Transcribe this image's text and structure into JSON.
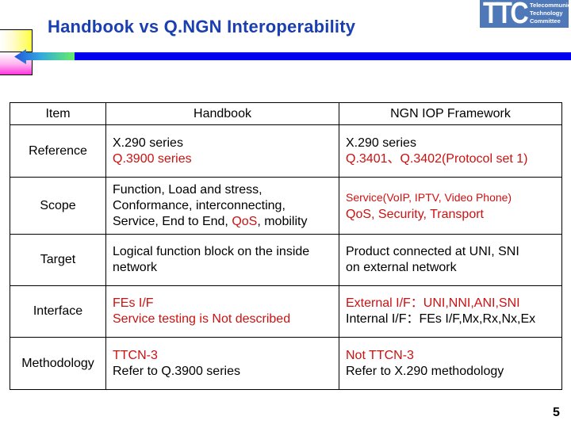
{
  "slide": {
    "title": "Handbook vs Q.NGN Interoperability",
    "page_number": "5",
    "colors": {
      "title": "#1a3fb0",
      "accent_bar": "#0000ee",
      "highlight_text": "#cc1111",
      "logo_bg": "#4f78b8"
    }
  },
  "logo": {
    "mark": "TTC",
    "lines": [
      "Telecommunication",
      "Technology",
      "Committee"
    ]
  },
  "table": {
    "headers": [
      "Item",
      "Handbook",
      "NGN IOP Framework"
    ],
    "rows": [
      {
        "item": "Reference",
        "handbook": [
          {
            "text": "X.290 series",
            "highlight": false
          },
          {
            "text": "Q.3900 series",
            "highlight": true
          }
        ],
        "framework": [
          {
            "text": "X.290 series",
            "highlight": false
          },
          {
            "text": "Q.3401、Q.3402(Protocol set 1)",
            "highlight": true
          }
        ]
      },
      {
        "item": "Scope",
        "handbook_lines": [
          "Function, Load and stress,",
          "Conformance, interconnecting,"
        ],
        "handbook_last_line": {
          "before": "Service, End to End, ",
          "highlight": "QoS",
          "after": ", mobility"
        },
        "framework": [
          {
            "text": "Service(VoIP, IPTV, Video Phone)",
            "highlight": true
          },
          {
            "text": "QoS, Security, Transport",
            "highlight": true
          }
        ]
      },
      {
        "item": "Target",
        "handbook": [
          {
            "text": "Logical function block on the inside",
            "highlight": false
          },
          {
            "text": "network",
            "highlight": false
          }
        ],
        "framework": [
          {
            "text": "Product connected at UNI, SNI",
            "highlight": false
          },
          {
            "text": "on external network",
            "highlight": false
          }
        ]
      },
      {
        "item": "Interface",
        "handbook": [
          {
            "text": "FEs I/F",
            "highlight": true
          },
          {
            "text": "Service testing is Not described",
            "highlight": true
          }
        ],
        "framework": [
          {
            "text": "External I/F：UNI,NNI,ANI,SNI",
            "highlight": true
          },
          {
            "text": "Internal I/F：FEs I/F,Mx,Rx,Nx,Ex",
            "highlight": false
          }
        ]
      },
      {
        "item": "Methodology",
        "handbook": [
          {
            "text": "TTCN-3",
            "highlight": true
          },
          {
            "text": "Refer to Q.3900 series",
            "highlight": false
          }
        ],
        "framework": [
          {
            "text": "Not TTCN-3",
            "highlight": true
          },
          {
            "text": "Refer to X.290 methodology",
            "highlight": false
          }
        ]
      }
    ]
  }
}
